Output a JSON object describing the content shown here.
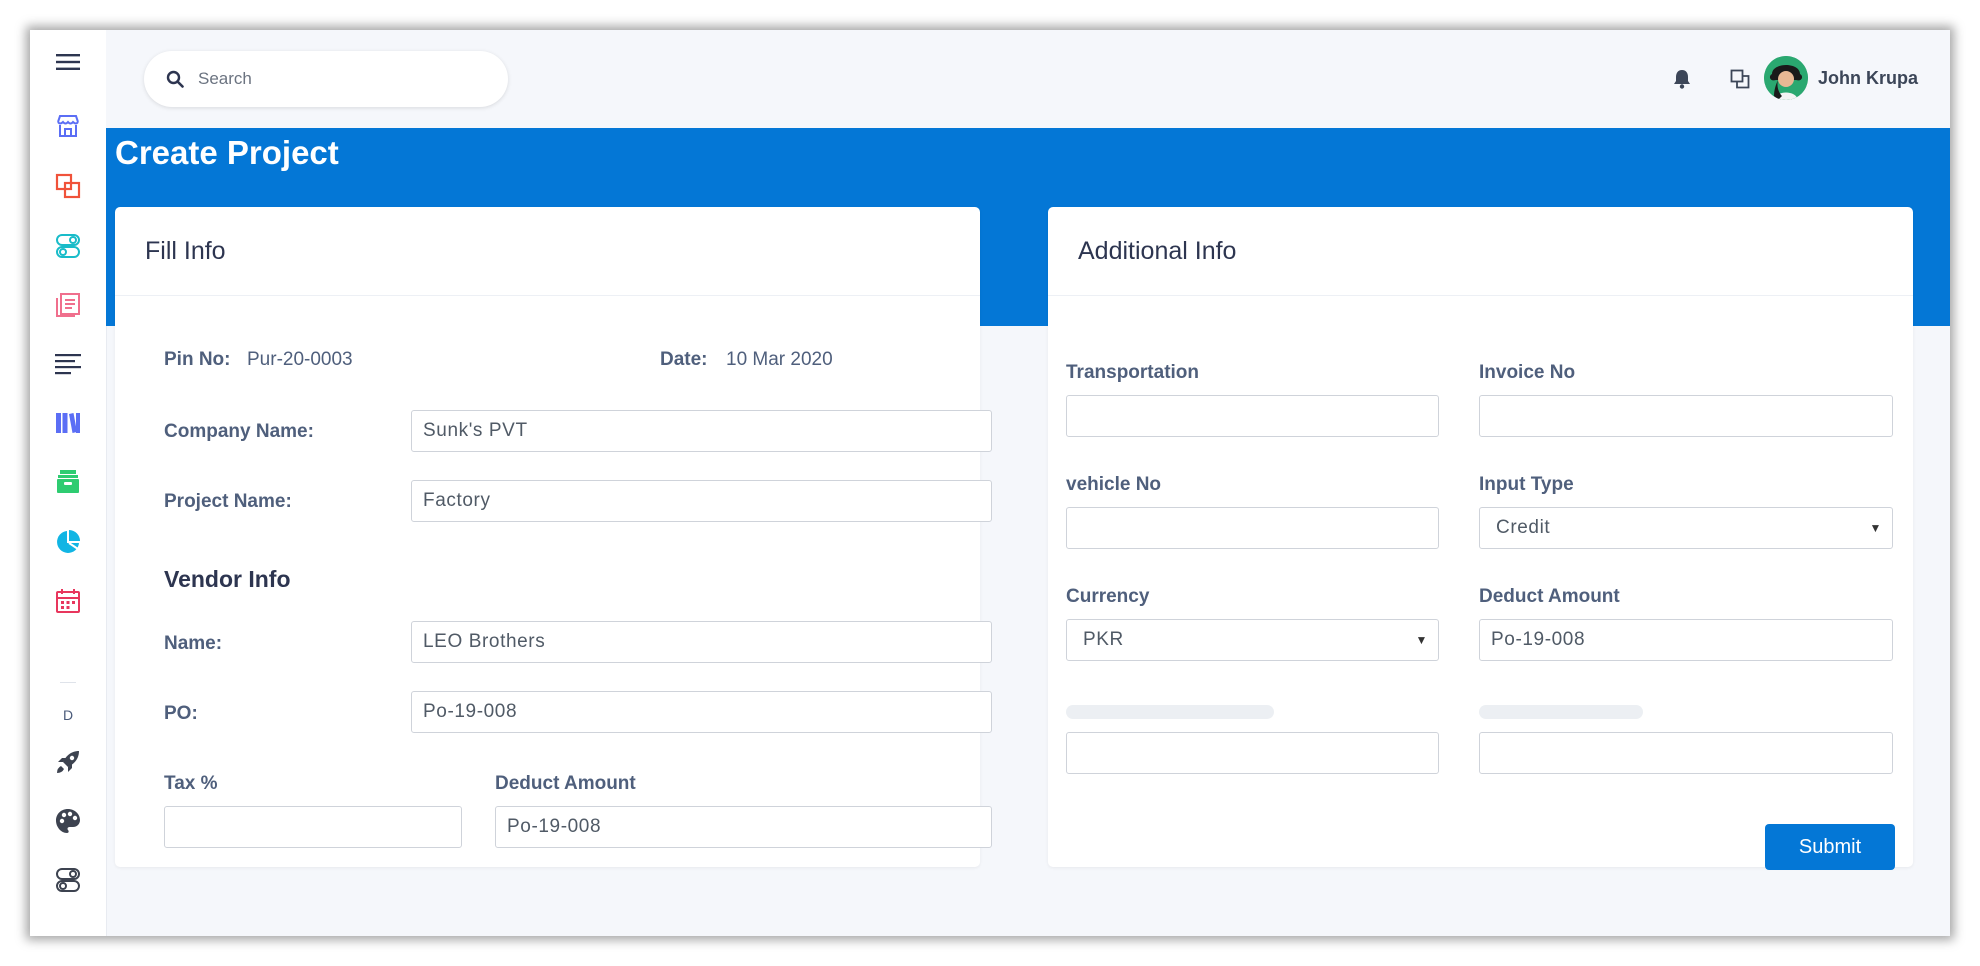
{
  "topbar": {
    "search_placeholder": "Search",
    "user_name": "John Krupa"
  },
  "sidebar": {
    "icons": [
      "store-icon",
      "copy-icon",
      "toggle-icon",
      "document-icon",
      "text-align-icon",
      "library-icon",
      "archive-icon",
      "pie-chart-icon",
      "calendar-icon",
      "rocket-icon",
      "palette-icon",
      "toggle-icon"
    ],
    "section_letter": "D",
    "colors": {
      "store": "#5b6ef5",
      "copy": "#f0523a",
      "toggle": "#19bcc9",
      "document": "#f06f8d",
      "text": "#2d3550",
      "library": "#5b6ef5",
      "archive": "#2ecc71",
      "pie": "#11b5e4",
      "calendar": "#e8365d",
      "dark": "#3d4350"
    }
  },
  "page": {
    "title": "Create Project",
    "accent_color": "#0477d6"
  },
  "fill_info": {
    "title": "Fill Info",
    "pin_label": "Pin No:",
    "pin_value": "Pur-20-0003",
    "date_label": "Date:",
    "date_value": "10 Mar 2020",
    "company_label": "Company Name:",
    "company_value": "Sunk's PVT",
    "project_label": "Project Name:",
    "project_value": "Factory",
    "vendor_title": "Vendor Info",
    "name_label": "Name:",
    "name_value": "LEO Brothers",
    "po_label": "PO:",
    "po_value": "Po-19-008",
    "tax_label": "Tax %",
    "tax_value": "",
    "deduct_label": "Deduct Amount",
    "deduct_value": "Po-19-008"
  },
  "additional_info": {
    "title": "Additional Info",
    "transportation_label": "Transportation",
    "transportation_value": "",
    "invoice_label": "Invoice No",
    "invoice_value": "",
    "vehicle_label": "vehicle No",
    "vehicle_value": "",
    "input_type_label": "Input Type",
    "input_type_value": "Credit",
    "currency_label": "Currency",
    "currency_value": "PKR",
    "deduct_label": "Deduct Amount",
    "deduct_value": "Po-19-008",
    "extra1_value": "",
    "extra2_value": "",
    "submit_label": "Submit"
  }
}
